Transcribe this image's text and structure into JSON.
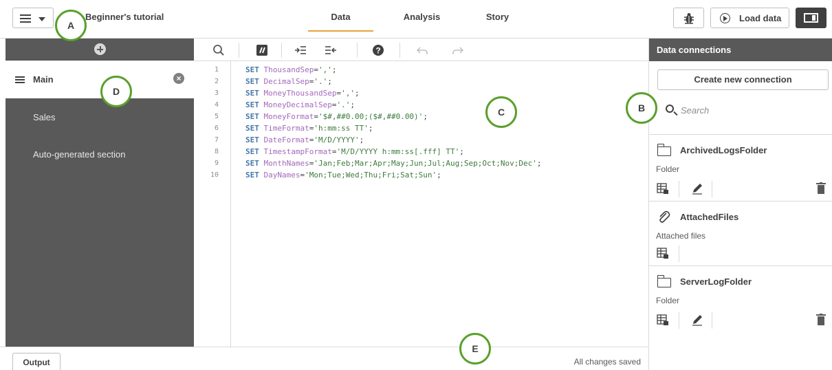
{
  "header": {
    "app_title": "Beginner's tutorial",
    "tabs": [
      {
        "label": "Data",
        "active": true
      },
      {
        "label": "Analysis",
        "active": false
      },
      {
        "label": "Story",
        "active": false
      }
    ],
    "load_data_label": "Load data",
    "accent_color": "#e8a23d"
  },
  "sidebar": {
    "sections": [
      {
        "label": "Main",
        "active": true
      },
      {
        "label": "Sales",
        "active": false
      },
      {
        "label": "Auto-generated section",
        "active": false
      }
    ]
  },
  "editor": {
    "toolbar_icons": [
      "search-icon",
      "comment-icon",
      "indent-icon",
      "outdent-icon",
      "help-icon",
      "undo-icon",
      "redo-icon"
    ],
    "lines": [
      {
        "no": "1",
        "kw": "SET",
        "var": "ThousandSep",
        "op": "=",
        "val": "','",
        "end": ";"
      },
      {
        "no": "2",
        "kw": "SET",
        "var": "DecimalSep",
        "op": "=",
        "val": "'.'",
        "end": ";"
      },
      {
        "no": "3",
        "kw": "SET",
        "var": "MoneyThousandSep",
        "op": "=",
        "val": "','",
        "end": ";"
      },
      {
        "no": "4",
        "kw": "SET",
        "var": "MoneyDecimalSep",
        "op": "=",
        "val": "'.'",
        "end": ";"
      },
      {
        "no": "5",
        "kw": "SET",
        "var": "MoneyFormat",
        "op": "=",
        "val": "'$#,##0.00;($#,##0.00)'",
        "end": ";"
      },
      {
        "no": "6",
        "kw": "SET",
        "var": "TimeFormat",
        "op": "=",
        "val": "'h:mm:ss TT'",
        "end": ";"
      },
      {
        "no": "7",
        "kw": "SET",
        "var": "DateFormat",
        "op": "=",
        "val": "'M/D/YYYY'",
        "end": ";"
      },
      {
        "no": "8",
        "kw": "SET",
        "var": "TimestampFormat",
        "op": "=",
        "val": "'M/D/YYYY h:mm:ss[.fff] TT'",
        "end": ";"
      },
      {
        "no": "9",
        "kw": "SET",
        "var": "MonthNames",
        "op": "=",
        "val": "'Jan;Feb;Mar;Apr;May;Jun;Jul;Aug;Sep;Oct;Nov;Dec'",
        "end": ";"
      },
      {
        "no": "10",
        "kw": "SET",
        "var": "DayNames",
        "op": "=",
        "val": "'Mon;Tue;Wed;Thu;Fri;Sat;Sun'",
        "end": ";"
      }
    ]
  },
  "connections_panel": {
    "title": "Data connections",
    "create_label": "Create new connection",
    "search_placeholder": "Search",
    "items": [
      {
        "name": "ArchivedLogsFolder",
        "type": "Folder",
        "icon": "folder-icon"
      },
      {
        "name": "AttachedFiles",
        "type": "Attached files",
        "icon": "paperclip-icon"
      },
      {
        "name": "ServerLogFolder",
        "type": "Folder",
        "icon": "folder-icon"
      }
    ]
  },
  "footer": {
    "output_label": "Output",
    "status": "All changes saved"
  },
  "callouts": [
    "A",
    "B",
    "C",
    "D",
    "E"
  ]
}
